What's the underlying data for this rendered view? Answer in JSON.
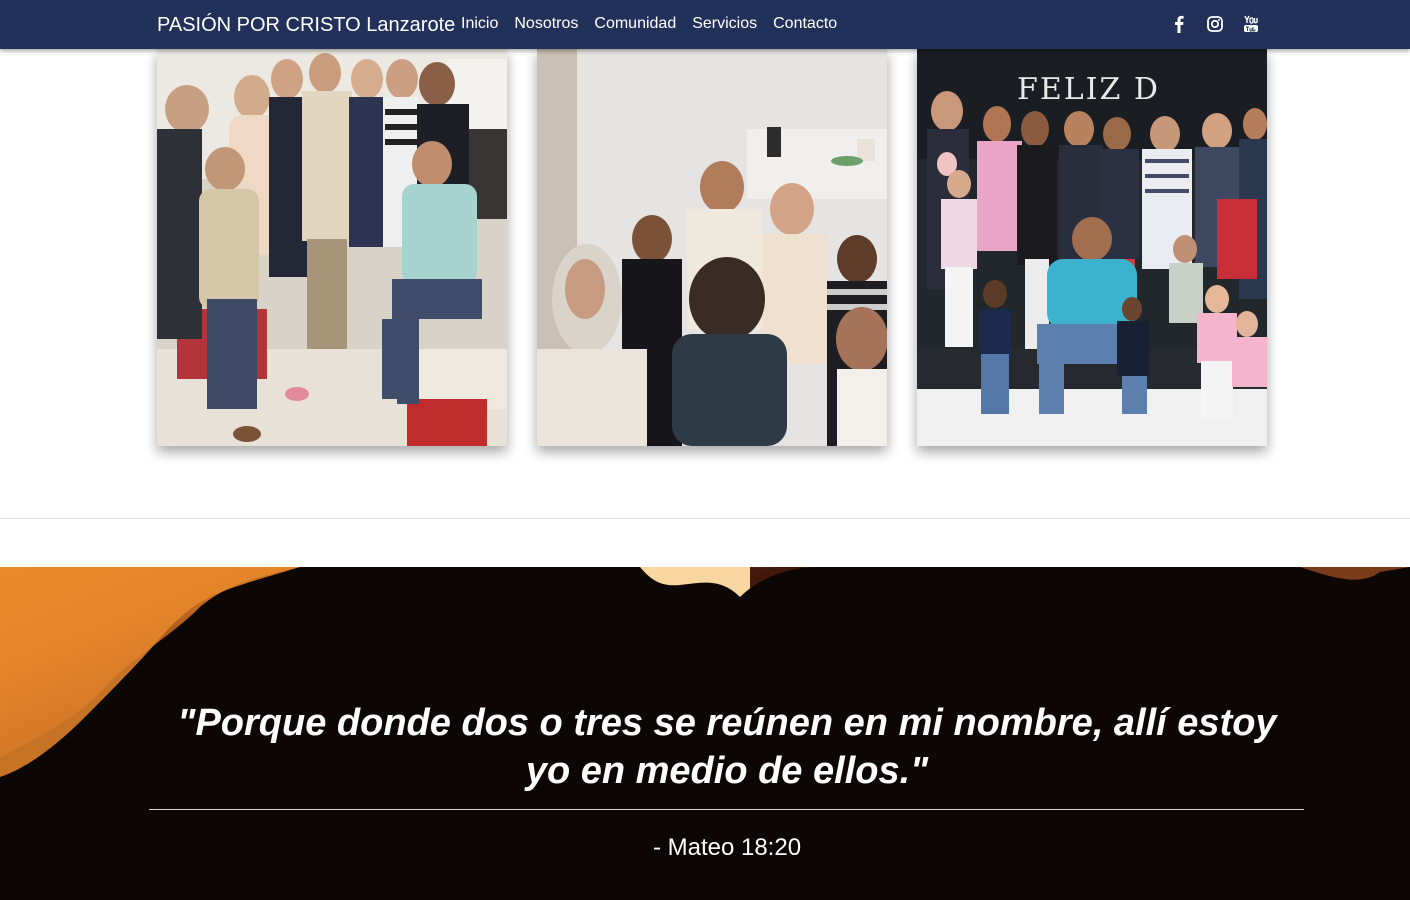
{
  "navbar": {
    "brand": "PASIÓN POR CRISTO Lanzarote",
    "links": [
      "Inicio",
      "Nosotros",
      "Comunidad",
      "Servicios",
      "Contacto"
    ],
    "social_icons": [
      "facebook-icon",
      "instagram-icon",
      "youtube-icon"
    ],
    "background": "#223159"
  },
  "gallery": {
    "banner_text": "FELIZ D"
  },
  "quote": {
    "text": "\"Porque donde dos o tres se reúnen en mi nombre, allí estoy yo en medio de ellos.\"",
    "reference": "- Mateo 18:20"
  }
}
